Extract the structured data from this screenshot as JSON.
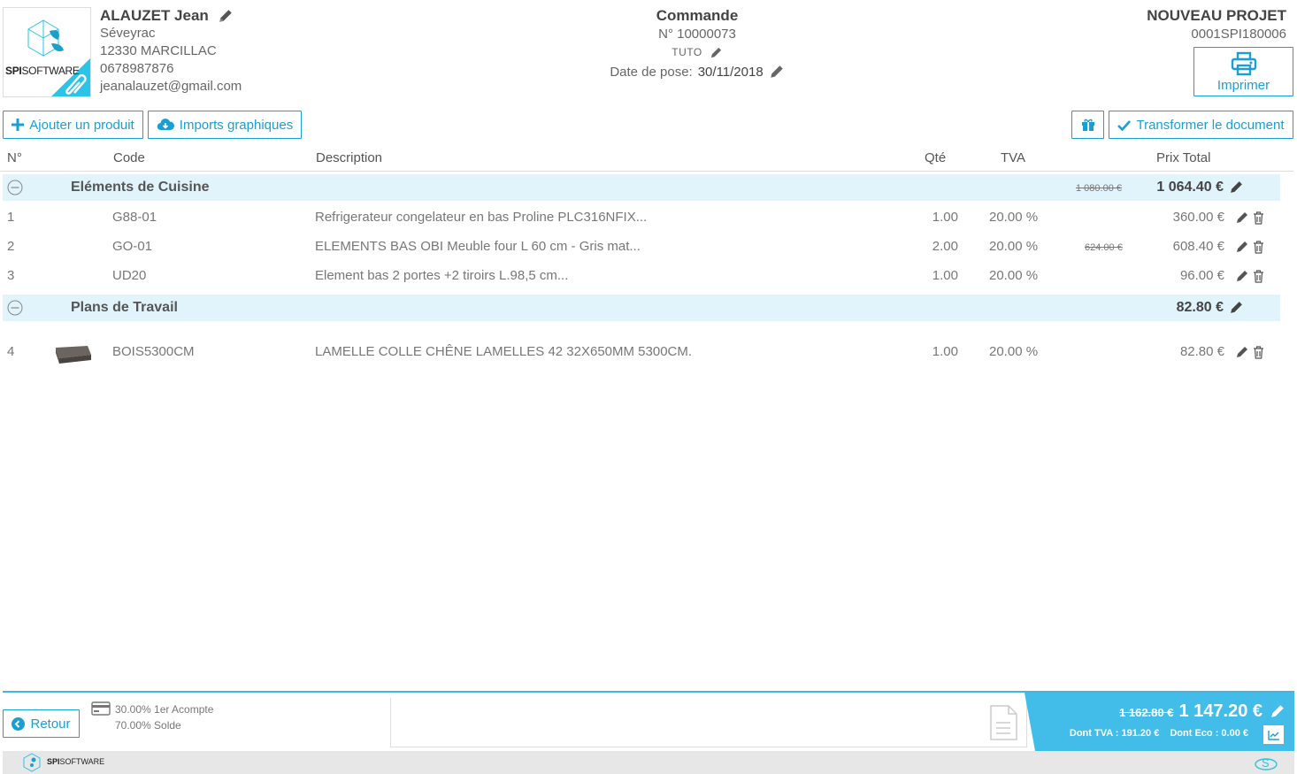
{
  "brand": {
    "logo_text": "SPISOFTWARE",
    "logo_bold": "SPI",
    "logo_light": "SOFTWARE",
    "accent": "#1a9fd4"
  },
  "client": {
    "name": "ALAUZET Jean",
    "address1": "Séveyrac",
    "address2": "12330 MARCILLAC",
    "phone": "0678987876",
    "email": "jeanalauzet@gmail.com"
  },
  "order": {
    "title": "Commande",
    "number": "N° 10000073",
    "tag": "TUTO",
    "pose_label": "Date de pose:",
    "pose_date": "30/11/2018"
  },
  "project": {
    "title": "NOUVEAU PROJET",
    "code": "0001SPI180006",
    "print_label": "Imprimer"
  },
  "toolbar": {
    "add_product": "Ajouter un produit",
    "imports": "Imports graphiques",
    "transform": "Transformer le document"
  },
  "table": {
    "headers": {
      "num": "N°",
      "code": "Code",
      "desc": "Description",
      "qty": "Qté",
      "tva": "TVA",
      "total": "Prix Total"
    },
    "groups": [
      {
        "name": "Eléments de Cuisine",
        "old_total": "1 080.00 €",
        "total": "1 064.40 €",
        "lines": [
          {
            "num": "1",
            "code": "G88-01",
            "desc": "Refrigerateur congelateur en bas Proline PLC316NFIX...",
            "qty": "1.00",
            "tva": "20.00 %",
            "old": "",
            "total": "360.00 €"
          },
          {
            "num": "2",
            "code": "GO-01",
            "desc": "ELEMENTS BAS OBI Meuble four L 60 cm - Gris mat...",
            "qty": "2.00",
            "tva": "20.00 %",
            "old": "624.00 €",
            "total": "608.40 €"
          },
          {
            "num": "3",
            "code": "UD20",
            "desc": "Element bas 2 portes +2 tiroirs L.98,5 cm...",
            "qty": "1.00",
            "tva": "20.00 %",
            "old": "",
            "total": "96.00 €"
          }
        ]
      },
      {
        "name": "Plans de Travail",
        "old_total": "",
        "total": "82.80 €",
        "lines": [
          {
            "num": "4",
            "code": "BOIS5300CM",
            "desc": "LAMELLE COLLE CHÊNE LAMELLES 42 32X650MM 5300CM.",
            "qty": "1.00",
            "tva": "20.00 %",
            "old": "",
            "total": "82.80 €"
          }
        ]
      }
    ]
  },
  "footer": {
    "back": "Retour",
    "payment1": "30.00% 1er Acompte",
    "payment2": "70.00% Solde",
    "old_total": "1 162.80 €",
    "total": "1 147.20 €",
    "tva": "Dont TVA : 191.20 €",
    "eco": "Dont Eco : 0.00 €"
  }
}
